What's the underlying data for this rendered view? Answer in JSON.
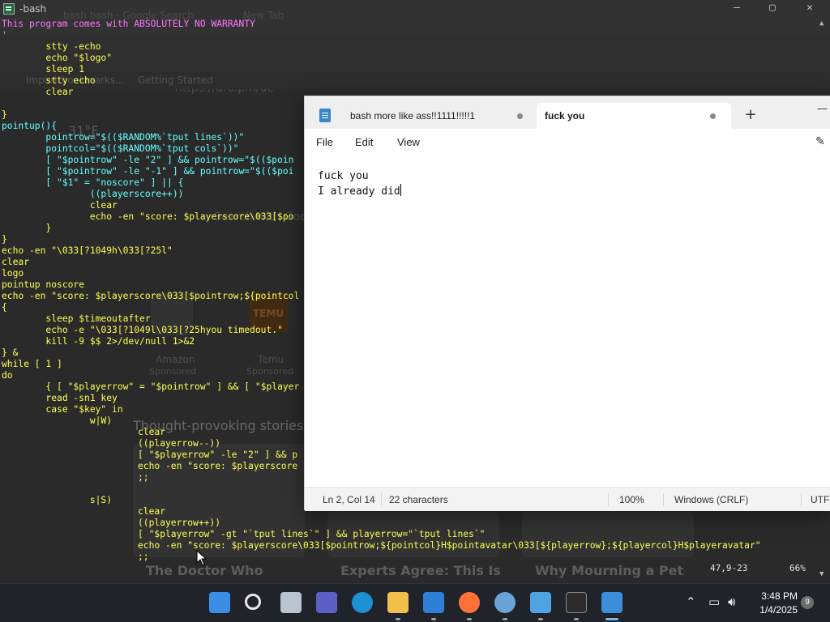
{
  "background_browser": {
    "tabs": [
      "bash bash - Google Search",
      "New Tab"
    ],
    "url": "https://dro.pm/ue",
    "bookmarks": [
      "Import bookmarks...",
      "Getting Started"
    ],
    "weather": "31°F",
    "search_placeholder": "Search with Google",
    "tiles": [
      {
        "label": "Amazon",
        "sub": "Sponsored"
      },
      {
        "label": "Temu",
        "sub": "Sponsored"
      }
    ],
    "section_heading": "Thought-provoking stories",
    "headlines": [
      "The Doctor Who",
      "Experts Agree: This Is",
      "Why Mourning a Pet"
    ],
    "tile_logo": "TEMU"
  },
  "terminal": {
    "title": "-bash",
    "lines": [
      "This program comes with ABSOLUTELY NO WARRANTY",
      "'",
      "        stty -echo",
      "        echo \"$logo\"",
      "        sleep 1",
      "        stty echo",
      "        clear",
      "",
      "}",
      "pointup(){",
      "        pointrow=\"$(($RANDOM%`tput lines`))\"",
      "        pointcol=\"$(($RANDOM%`tput cols`))\"",
      "        [ \"$pointrow\" -le \"2\" ] && pointrow=\"$(($poin",
      "        [ \"$pointrow\" -le \"-1\" ] && pointrow=\"$(($poi",
      "        [ \"$1\" = \"noscore\" ] || {",
      "                ((playerscore++))",
      "                clear",
      "                echo -en \"score: $playerscore\\033[$po",
      "        }",
      "}",
      "echo -en \"\\033[?1049h\\033[?25l\"",
      "clear",
      "logo",
      "pointup noscore",
      "echo -en \"score: $playerscore\\033[$pointrow;${pointcol",
      "{",
      "        sleep $timeoutafter",
      "        echo -e \"\\033[?1049l\\033[?25hyou timedout.\"",
      "        kill -9 $$ 2>/dev/null 1>&2",
      "} &",
      "while [ 1 ]",
      "do",
      "        { [ \"$playerrow\" = \"$pointrow\" ] && [ \"$player",
      "        read -sn1 key",
      "        case \"$key\" in",
      "                w|W)",
      "                        clear",
      "                        ((playerrow--))",
      "                        [ \"$playerrow\" -le \"2\" ] && p",
      "                        echo -en \"score: $playerscore",
      "                        ;;",
      "",
      "                s|S)",
      "                        clear",
      "                        ((playerrow++))",
      "                        [ \"$playerrow\" -gt \"`tput lines`\" ] && playerrow=\"`tput lines`\"",
      "                        echo -en \"score: $playerscore\\033[$pointrow;${pointcol}H$pointavatar\\033[${playerrow};${playercol}H$playeravatar\"",
      "                        ;;"
    ],
    "status_position": "47,9-23",
    "status_percent": "66%"
  },
  "notepad": {
    "tabs": [
      {
        "label": "bash more like ass!!1111!!!!!1",
        "active": false
      },
      {
        "label": "fuck you",
        "active": true
      }
    ],
    "new_tab_label": "+",
    "menu": [
      "File",
      "Edit",
      "View"
    ],
    "content": "fuck you\nI already did",
    "status": {
      "position": "Ln 2, Col 14",
      "characters": "22 characters",
      "zoom": "100%",
      "line_ending": "Windows (CRLF)",
      "encoding": "UTF-"
    }
  },
  "taskbar": {
    "apps": [
      "start",
      "search",
      "task-view",
      "meet",
      "edge",
      "file-explorer",
      "store",
      "firefox",
      "settings",
      "remote-desktop",
      "terminal",
      "notepad"
    ],
    "time": "3:48 PM",
    "date": "1/4/2025",
    "notification_count": "9"
  }
}
